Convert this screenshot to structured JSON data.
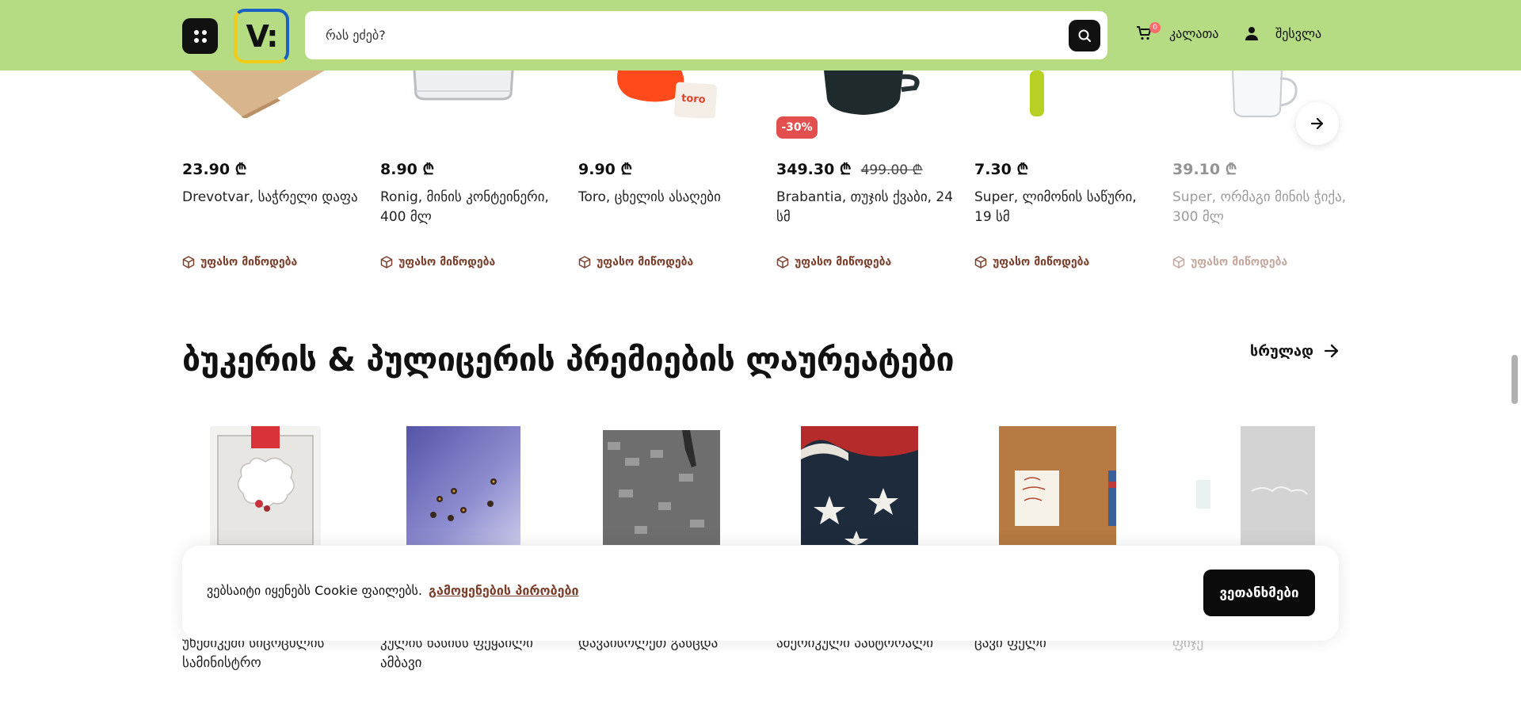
{
  "header": {
    "logo_text": "V:",
    "search_placeholder": "რას ეძებ?",
    "cart_label": "კალათა",
    "cart_count": "0",
    "login_label": "შესვლა"
  },
  "products": [
    {
      "price": "23.90 ₾",
      "name": "Drevotvar, საჭრელი დაფა",
      "shipping": "უფასო მიწოდება"
    },
    {
      "price": "8.90 ₾",
      "name": "Ronig, მინის კონტეინერი, 400 მლ",
      "shipping": "უფასო მიწოდება"
    },
    {
      "price": "9.90 ₾",
      "name": "Toro, ცხელის ასაღები",
      "shipping": "უფასო მიწოდება"
    },
    {
      "price": "349.30 ₾",
      "old_price": "499.00 ₾",
      "discount": "-30%",
      "name": "Brabantia, თუჯის ქვაბი, 24 სმ",
      "shipping": "უფასო მიწოდება"
    },
    {
      "price": "7.30 ₾",
      "name": "Super, ლიმონის საწური, 19 სმ",
      "shipping": "უფასო მიწოდება"
    },
    {
      "price": "39.10 ₾",
      "name": "Super, ორმაგი მინის ჭიქა, 300 მლ",
      "shipping": "უფასო მიწოდება"
    }
  ],
  "section": {
    "title": "ბუკერის & პულიცერის პრემიების ლაურეატები",
    "see_all": "სრულად"
  },
  "books": [
    {
      "title": "უხეშიკეში სიცოცხლის სამინისტრო"
    },
    {
      "title": "კულის ნასისს ფეყაილი ამბავი"
    },
    {
      "title": "დავაისოლეთ გასცდა"
    },
    {
      "title": "ამერიკული პასტორალი"
    },
    {
      "title": "ცავი ფელი"
    },
    {
      "title": "ფიჯე"
    }
  ],
  "cookie": {
    "text": "ვებსაიტი იყენებს Cookie ფაილებს.",
    "link": "გამოყენების პირობები",
    "accept": "ვეთანხმები"
  },
  "icons": {
    "menu": "grid-dots-icon",
    "search": "search-icon",
    "cart": "cart-icon",
    "user": "user-icon",
    "shipping": "box-icon",
    "next": "arrow-right-icon",
    "see_all": "arrow-right-icon"
  },
  "colors": {
    "header_bg": "#b5dc83",
    "accent_brown": "#7b3f2c",
    "discount_red": "#e34f4f",
    "badge_red": "#ff6b6b"
  }
}
